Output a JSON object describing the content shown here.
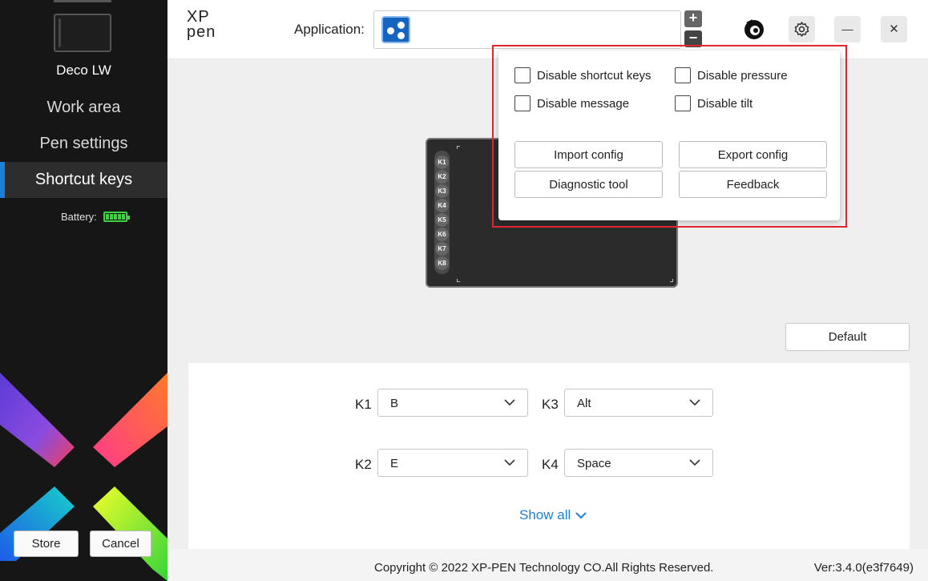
{
  "sidebar": {
    "device_name": "Deco LW",
    "nav": [
      {
        "label": "Work area"
      },
      {
        "label": "Pen settings"
      },
      {
        "label": "Shortcut keys"
      }
    ],
    "battery_label": "Battery:",
    "battery_level": 1.0,
    "store_label": "Store",
    "cancel_label": "Cancel"
  },
  "header": {
    "logo_top": "XP",
    "logo_bottom": "pen",
    "application_label": "Application:",
    "add_symbol": "+",
    "remove_symbol": "−",
    "minimize_symbol": "—",
    "close_symbol": "✕"
  },
  "popup": {
    "disable_shortcut_keys": "Disable shortcut keys",
    "disable_pressure": "Disable pressure",
    "disable_message": "Disable message",
    "disable_tilt": "Disable tilt",
    "import_config": "Import config",
    "export_config": "Export config",
    "diagnostic_tool": "Diagnostic tool",
    "feedback": "Feedback"
  },
  "tablet": {
    "keys": [
      "K1",
      "K2",
      "K3",
      "K4",
      "K5",
      "K6",
      "K7",
      "K8"
    ]
  },
  "default_label": "Default",
  "shortcuts": {
    "k1": {
      "label": "K1",
      "value": "B"
    },
    "k2": {
      "label": "K2",
      "value": "E"
    },
    "k3": {
      "label": "K3",
      "value": "Alt"
    },
    "k4": {
      "label": "K4",
      "value": "Space"
    }
  },
  "show_all_label": "Show all",
  "footer": {
    "copyright": "Copyright © 2022  XP-PEN Technology CO.All Rights Reserved.",
    "version": "Ver:3.4.0(e3f7649)"
  },
  "colors": {
    "accent": "#1e7fd6",
    "highlight": "#e0262f",
    "battery": "#3cd43c",
    "sidebar_bg": "#161616"
  }
}
